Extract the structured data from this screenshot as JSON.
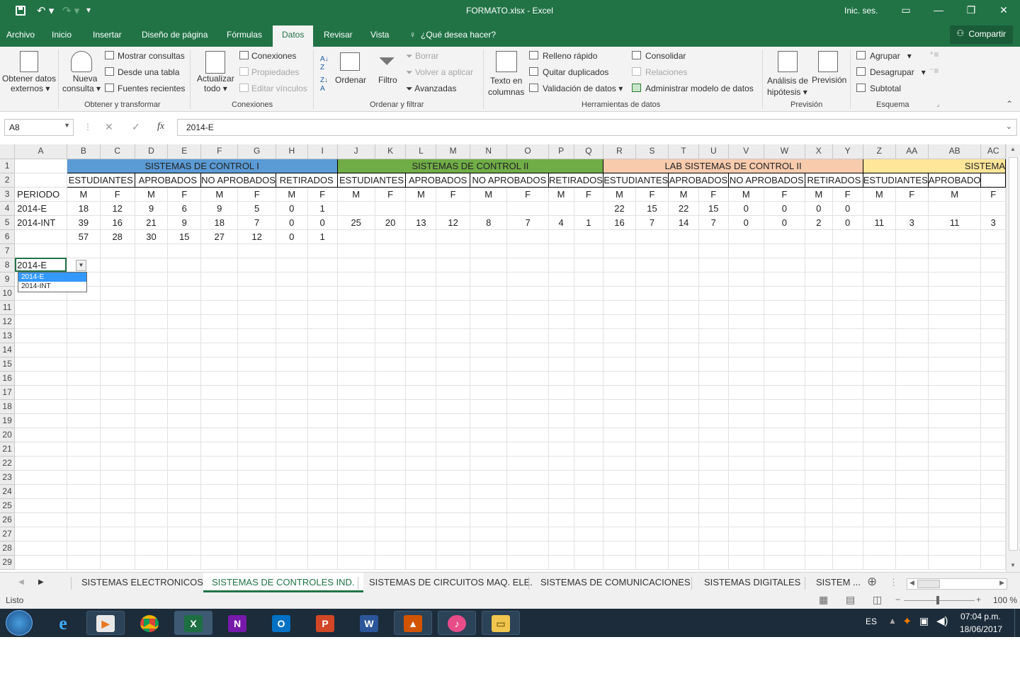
{
  "window": {
    "title": "FORMATO.xlsx  -  Excel",
    "signin": "Inic. ses."
  },
  "ribbon_tabs": [
    "Archivo",
    "Inicio",
    "Insertar",
    "Diseño de página",
    "Fórmulas",
    "Datos",
    "Revisar",
    "Vista"
  ],
  "active_tab": "Datos",
  "tell_me": "¿Qué desea hacer?",
  "share": "Compartir",
  "ribbon": {
    "obtener_datos": [
      "Obtener datos",
      "externos ▾"
    ],
    "nueva_consulta": [
      "Nueva",
      "consulta ▾"
    ],
    "mostrar_consultas": "Mostrar consultas",
    "desde_tabla": "Desde una tabla",
    "fuentes_recientes": "Fuentes recientes",
    "actualizar": [
      "Actualizar",
      "todo ▾"
    ],
    "conexiones": "Conexiones",
    "propiedades": "Propiedades",
    "editar_vinculos": "Editar vínculos",
    "ordenar": "Ordenar",
    "filtro": "Filtro",
    "borrar": "Borrar",
    "volver_aplicar": "Volver a aplicar",
    "avanzadas": "Avanzadas",
    "texto_columnas": [
      "Texto en",
      "columnas"
    ],
    "relleno_rapido": "Relleno rápido",
    "quitar_duplicados": "Quitar duplicados",
    "validacion": "Validación de datos",
    "consolidar": "Consolidar",
    "relaciones": "Relaciones",
    "administrar_modelo": "Administrar modelo de datos",
    "analisis": [
      "Análisis de",
      "hipótesis ▾"
    ],
    "prevision": "Previsión",
    "agrupar": "Agrupar",
    "desagrupar": "Desagrupar",
    "subtotal": "Subtotal",
    "groups": [
      "Obtener y transformar",
      "Conexiones",
      "Ordenar y filtrar",
      "Herramientas de datos",
      "Previsión",
      "Esquema"
    ]
  },
  "formula_bar": {
    "name_box": "A8",
    "fx": "fx",
    "value": "2014-E"
  },
  "columns": [
    "A",
    "B",
    "C",
    "D",
    "E",
    "F",
    "G",
    "H",
    "I",
    "J",
    "K",
    "L",
    "M",
    "N",
    "O",
    "P",
    "Q",
    "R",
    "S",
    "T",
    "U",
    "V",
    "W",
    "X",
    "Y",
    "Z",
    "AA",
    "AB",
    "AC"
  ],
  "rows": [
    "1",
    "2",
    "3",
    "4",
    "5",
    "6",
    "7",
    "8",
    "9",
    "10",
    "11",
    "12",
    "13",
    "14",
    "15",
    "16",
    "17",
    "18",
    "19",
    "20",
    "21",
    "22",
    "23",
    "24",
    "25",
    "26",
    "27",
    "28",
    "29"
  ],
  "sheet": {
    "h1": {
      "a": "SISTEMAS DE CONTROL I",
      "b": "SISTEMAS DE CONTROL II",
      "c": "LAB SISTEMAS DE CONTROL II",
      "d": "SISTEMA"
    },
    "h2": [
      "ESTUDIANTES",
      "APROBADOS",
      "NO APROBADOS",
      "RETIRADOS",
      "ESTUDIANTES",
      "APROBADOS",
      "NO APROBADOS",
      "RETIRADOS",
      "ESTUDIANTES",
      "APROBADOS",
      "NO APROBADOS",
      "RETIRADOS",
      "ESTUDIANTES",
      "APROBADO"
    ],
    "r3": [
      "PERIODO",
      "M",
      "F",
      "M",
      "F",
      "M",
      "F",
      "M",
      "F",
      "M",
      "F",
      "M",
      "F",
      "M",
      "F",
      "M",
      "F",
      "M",
      "F",
      "M",
      "F",
      "M",
      "F",
      "M",
      "F",
      "M",
      "F",
      "M",
      "F"
    ],
    "r4": [
      "2014-E",
      "18",
      "12",
      "9",
      "6",
      "9",
      "5",
      "0",
      "1",
      "",
      "",
      "",
      "",
      "",
      "",
      "",
      "",
      "22",
      "15",
      "22",
      "15",
      "0",
      "0",
      "0",
      "0",
      "",
      "",
      "",
      ""
    ],
    "r5": [
      "2014-INT",
      "39",
      "16",
      "21",
      "9",
      "18",
      "7",
      "0",
      "0",
      "25",
      "20",
      "13",
      "12",
      "8",
      "7",
      "4",
      "1",
      "16",
      "7",
      "14",
      "7",
      "0",
      "0",
      "2",
      "0",
      "11",
      "3",
      "11",
      "3"
    ],
    "r6": [
      "",
      "57",
      "28",
      "30",
      "15",
      "27",
      "12",
      "0",
      "1",
      "",
      "",
      "",
      "",
      "",
      "",
      "",
      "",
      "",
      "",
      "",
      "",
      "",
      "",
      "",
      "",
      "",
      "",
      "",
      ""
    ],
    "r8": "2014-E"
  },
  "dropdown": [
    "2014-E",
    "2014-INT"
  ],
  "sheet_tabs": [
    "SISTEMAS ELECTRONICOS",
    "SISTEMAS DE CONTROLES IND.",
    "SISTEMAS DE CIRCUITOS MAQ. ELE.",
    "SISTEMAS DE COMUNICACIONES",
    "SISTEMAS DIGITALES",
    "SISTEM ..."
  ],
  "active_sheet": "SISTEMAS DE CONTROLES IND.",
  "status": {
    "left": "Listo",
    "zoom": "100 %"
  },
  "taskbar": {
    "lang": "ES",
    "time": "07:04 p.m.",
    "date": "18/06/2017"
  },
  "colors": {
    "excel_green": "#217346",
    "header_blue": "#5b9bd5",
    "header_green": "#70ad47",
    "header_salmon": "#f8cbad",
    "header_yellow": "#ffe699"
  }
}
